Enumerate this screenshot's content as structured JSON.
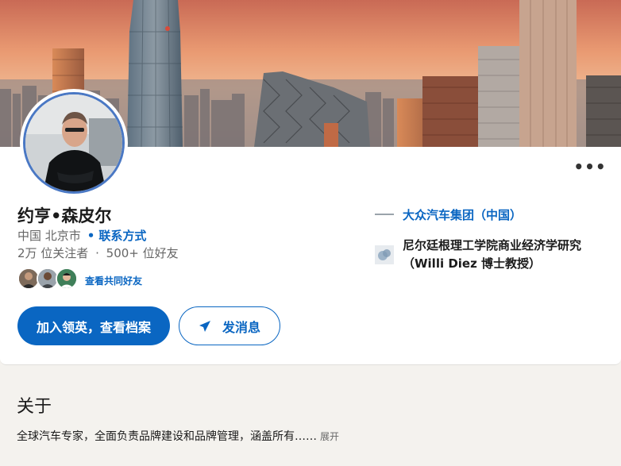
{
  "profile": {
    "name": "约亨•森皮尔",
    "location": "中国 北京市",
    "contact_link": "联系方式",
    "followers": "2万 位关注者",
    "separator": "·",
    "connections": "500+ 位好友",
    "mutual_link": "查看共同好友"
  },
  "actions": {
    "join_button": "加入领英，查看档案",
    "message_button": "发消息",
    "more_button": "•••"
  },
  "experience": {
    "company": "大众汽车集团（中国）",
    "school": "尼尔廷根理工学院商业经济学研究（Willi Diez 博士教授）"
  },
  "about": {
    "title": "关于",
    "text": "全球汽车专家，全面负责品牌建设和品牌管理，涵盖所有……",
    "expand": "展开"
  },
  "colors": {
    "brand_blue": "#0a66c2",
    "avatar_ring": "#4a78c4"
  },
  "icons": [
    "more-icon",
    "send-icon",
    "company-logo",
    "school-logo"
  ]
}
